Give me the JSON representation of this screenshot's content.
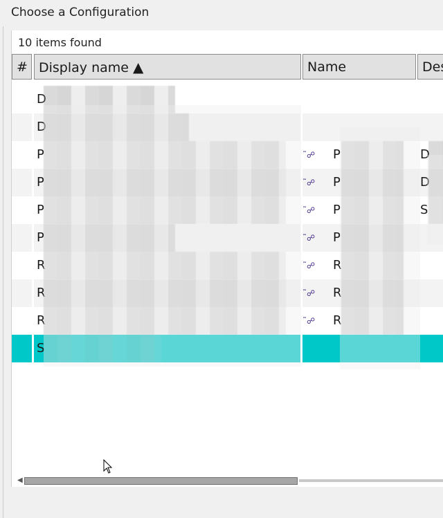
{
  "window": {
    "title": "Choose a Configuration"
  },
  "list": {
    "count_label": "10 items found",
    "columns": [
      {
        "label": "#"
      },
      {
        "label": "Display name",
        "sort": "ascending",
        "sort_glyph": "▲"
      },
      {
        "label": "Name"
      },
      {
        "label": "Des"
      }
    ],
    "rows": [
      {
        "display_initial": "D",
        "name_initial": "",
        "desc_initial": "",
        "has_link_icon": false,
        "selected": false
      },
      {
        "display_initial": "D",
        "name_initial": "",
        "desc_initial": "",
        "has_link_icon": false,
        "selected": false
      },
      {
        "display_initial": "P",
        "name_initial": "P",
        "desc_initial": "D",
        "has_link_icon": true,
        "selected": false
      },
      {
        "display_initial": "P",
        "name_initial": "P",
        "desc_initial": "D",
        "has_link_icon": true,
        "selected": false
      },
      {
        "display_initial": "P",
        "name_initial": "P",
        "desc_initial": "S",
        "has_link_icon": true,
        "selected": false
      },
      {
        "display_initial": "P",
        "name_initial": "P",
        "desc_initial": "",
        "has_link_icon": true,
        "selected": false
      },
      {
        "display_initial": "R",
        "name_initial": "R",
        "desc_initial": "",
        "has_link_icon": true,
        "selected": false
      },
      {
        "display_initial": "R",
        "name_initial": "R",
        "desc_initial": "",
        "has_link_icon": true,
        "selected": false
      },
      {
        "display_initial": "R",
        "name_initial": "R",
        "desc_initial": "",
        "has_link_icon": true,
        "selected": false
      },
      {
        "display_initial": "S",
        "name_initial": "",
        "desc_initial": "",
        "has_link_icon": false,
        "selected": true
      }
    ]
  },
  "icons": {
    "link": "relationship-link-icon",
    "sort": "sort-ascending-icon",
    "cursor": "mouse-pointer-icon"
  },
  "colors": {
    "selection": "#00c8c8",
    "header_bg": "#e1e1e1",
    "link_icon": "#4a2e8a"
  }
}
